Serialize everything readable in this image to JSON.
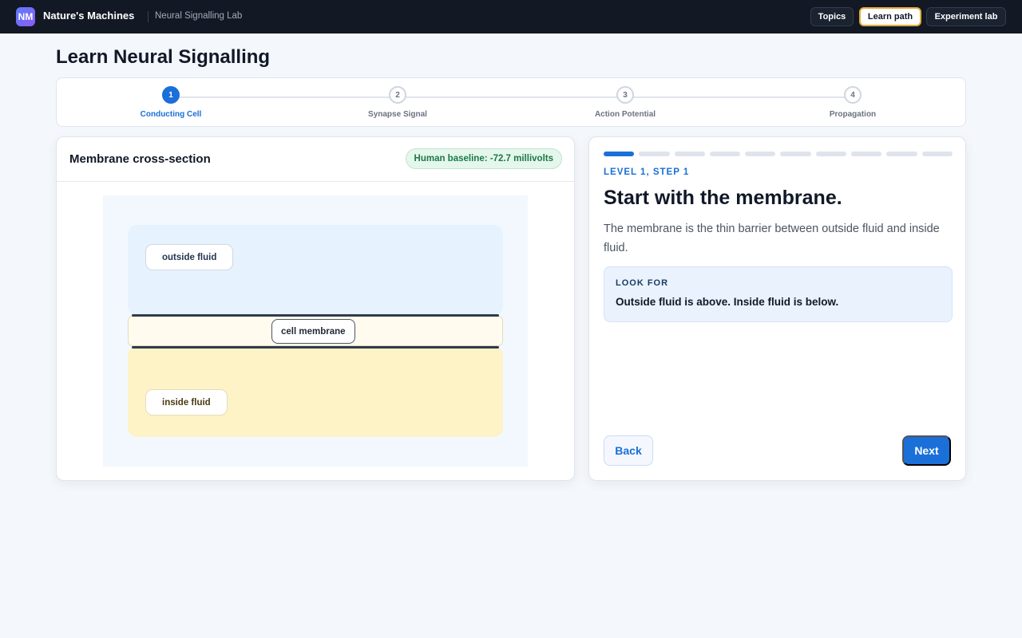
{
  "app": {
    "logo": "NM",
    "name": "Nature's Machines",
    "subtitle": "Neural Signalling Lab"
  },
  "nav": {
    "items": [
      {
        "label": "Topics",
        "active": false
      },
      {
        "label": "Learn path",
        "active": true
      },
      {
        "label": "Experiment lab",
        "active": false
      }
    ]
  },
  "page": {
    "title": "Learn Neural Signalling"
  },
  "stepper": {
    "steps": [
      {
        "number": "1",
        "label": "Conducting Cell",
        "active": true
      },
      {
        "number": "2",
        "label": "Synapse Signal",
        "active": false
      },
      {
        "number": "3",
        "label": "Action Potential",
        "active": false
      },
      {
        "number": "4",
        "label": "Propagation",
        "active": false
      }
    ]
  },
  "diagram": {
    "title": "Membrane cross-section",
    "baseline_badge": "Human baseline: -72.7 millivolts",
    "labels": {
      "outside": "outside fluid",
      "membrane": "cell membrane",
      "inside": "inside fluid"
    }
  },
  "lesson": {
    "progress": {
      "completed": 1,
      "total": 10
    },
    "level": "LEVEL 1, STEP 1",
    "title": "Start with the membrane.",
    "body": "The membrane is the thin barrier between outside fluid and inside fluid.",
    "look_for": {
      "heading": "LOOK FOR",
      "text": "Outside fluid is above. Inside fluid is below."
    },
    "back_label": "Back",
    "next_label": "Next"
  },
  "colors": {
    "accent": "#1a6fd8",
    "topbar": "#121824",
    "active_nav_border": "#e8a93a",
    "badge_green": "#1a7a45",
    "outside_fluid": "#e6f2fd",
    "inside_fluid": "#fef2c7"
  }
}
